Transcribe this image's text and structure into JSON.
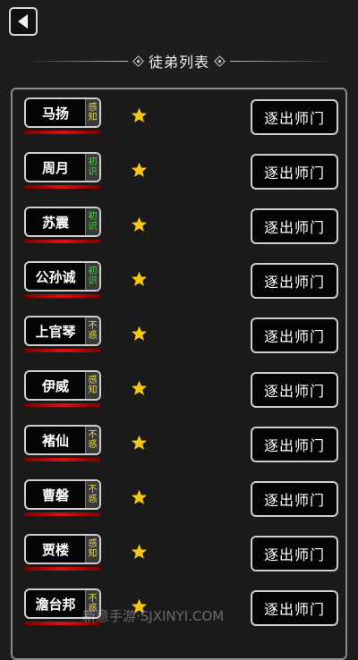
{
  "header": {
    "title": "徒弟列表",
    "back_icon": "back-arrow-icon"
  },
  "colors": {
    "tag_green": "#3ee03e",
    "tag_yellow": "#e8d84a",
    "star": "#f5c518",
    "underline_red": "#e01010"
  },
  "disciples": [
    {
      "name": "马扬",
      "tag": [
        "感",
        "知"
      ],
      "tag_color": "yellow",
      "stars": 1,
      "action": "逐出师门"
    },
    {
      "name": "周月",
      "tag": [
        "初",
        "识"
      ],
      "tag_color": "green",
      "stars": 1,
      "action": "逐出师门"
    },
    {
      "name": "苏震",
      "tag": [
        "初",
        "识"
      ],
      "tag_color": "green",
      "stars": 1,
      "action": "逐出师门"
    },
    {
      "name": "公孙诚",
      "tag": [
        "初",
        "识"
      ],
      "tag_color": "green",
      "stars": 1,
      "action": "逐出师门"
    },
    {
      "name": "上官琴",
      "tag": [
        "不",
        "惑"
      ],
      "tag_color": "yellow",
      "stars": 1,
      "action": "逐出师门"
    },
    {
      "name": "伊威",
      "tag": [
        "感",
        "知"
      ],
      "tag_color": "yellow",
      "stars": 1,
      "action": "逐出师门"
    },
    {
      "name": "褚仙",
      "tag": [
        "不",
        "惑"
      ],
      "tag_color": "yellow",
      "stars": 1,
      "action": "逐出师门"
    },
    {
      "name": "曹磐",
      "tag": [
        "不",
        "惑"
      ],
      "tag_color": "yellow",
      "stars": 1,
      "action": "逐出师门"
    },
    {
      "name": "贾楼",
      "tag": [
        "感",
        "知"
      ],
      "tag_color": "yellow",
      "stars": 1,
      "action": "逐出师门"
    },
    {
      "name": "澹台邦",
      "tag": [
        "不",
        "惑"
      ],
      "tag_color": "yellow",
      "stars": 1,
      "action": "逐出师门"
    }
  ],
  "watermark": "新意手游·SJXINYI.COM"
}
